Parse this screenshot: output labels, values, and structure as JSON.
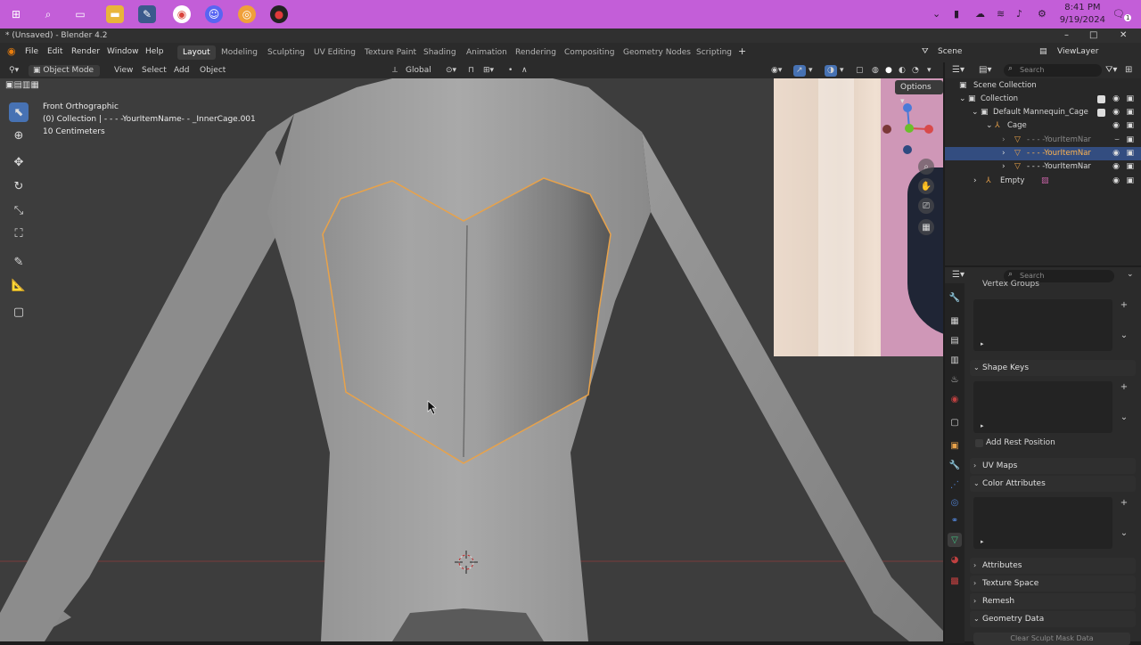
{
  "taskbar": {
    "clock_time": "8:41 PM",
    "clock_date": "9/19/2024",
    "notification_count": "1"
  },
  "window": {
    "title": "* (Unsaved) - Blender 4.2",
    "minimize": "–",
    "maximize": "□",
    "close": "✕"
  },
  "menu": {
    "items": [
      "File",
      "Edit",
      "Render",
      "Window",
      "Help"
    ]
  },
  "workspaces": [
    "Layout",
    "Modeling",
    "Sculpting",
    "UV Editing",
    "Texture Paint",
    "Shading",
    "Animation",
    "Rendering",
    "Compositing",
    "Geometry Nodes",
    "Scripting"
  ],
  "scene": {
    "scene_label": "Scene",
    "viewlayer_label": "ViewLayer"
  },
  "viewport_header": {
    "mode": "Object Mode",
    "menus": [
      "View",
      "Select",
      "Add",
      "Object"
    ],
    "orientation": "Global",
    "options": "Options"
  },
  "viewport_overlay": {
    "view_name": "Front Orthographic",
    "collection_info": "(0) Collection | - - - -YourItemName- - _InnerCage.001",
    "scale": "10 Centimeters"
  },
  "outliner": {
    "search_placeholder": "Search",
    "rows": [
      {
        "label": "Scene Collection"
      },
      {
        "label": "Collection"
      },
      {
        "label": "Default Mannequin_Cage"
      },
      {
        "label": "Cage"
      },
      {
        "label": "- - - -YourItemNar"
      },
      {
        "label": "- - - -YourItemNar"
      },
      {
        "label": "- - - -YourItemNar"
      },
      {
        "label": "Empty"
      }
    ]
  },
  "properties": {
    "search_placeholder": "Search",
    "vertex_groups": "Vertex Groups",
    "shape_keys": "Shape Keys",
    "add_rest_position": "Add Rest Position",
    "uv_maps": "UV Maps",
    "color_attributes": "Color Attributes",
    "attributes": "Attributes",
    "texture_space": "Texture Space",
    "remesh": "Remesh",
    "geometry_data": "Geometry Data",
    "clear_sculpt_mask": "Clear Sculpt Mask Data"
  },
  "colors": {
    "taskbar": "#c35ed8",
    "accent": "#4772b3",
    "selection_outline": "#e8a24a",
    "viewport_bg": "#3d3d3d"
  }
}
